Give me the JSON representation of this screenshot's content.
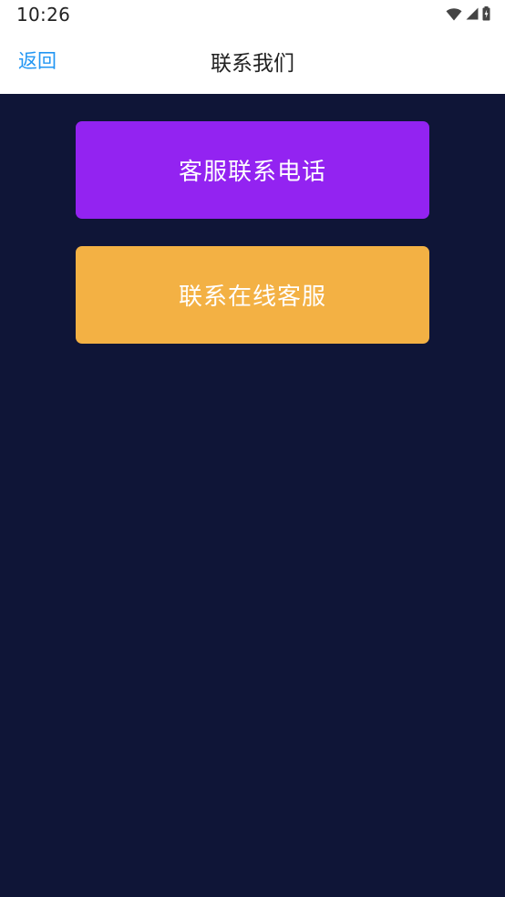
{
  "status_bar": {
    "time": "10:26",
    "icons": [
      "wifi-icon",
      "cellular-signal-icon",
      "battery-icon"
    ]
  },
  "header": {
    "back_label": "返回",
    "title": "联系我们"
  },
  "actions": {
    "phone_label": "客服联系电话",
    "online_label": "联系在线客服"
  },
  "colors": {
    "background": "#0f1537",
    "phone_button": "#9323f1",
    "online_button": "#f3b144",
    "back_link": "#2196f3"
  }
}
